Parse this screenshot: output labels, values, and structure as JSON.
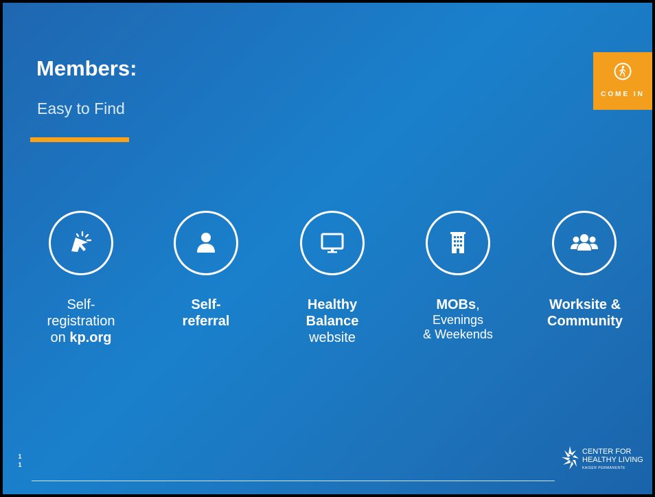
{
  "slide": {
    "title": "Members:",
    "subtitle": "Easy to Find",
    "badge": {
      "icon": "walking-person-icon",
      "label": "COME IN",
      "color": "#f39e1d"
    },
    "accent_color": "#f7a21a",
    "page_number": [
      "1",
      "1"
    ],
    "logo": {
      "line1": "CENTER FOR",
      "line2": "HEALTHY LIVING",
      "sub": "KAISER PERMANENTE"
    }
  },
  "items": [
    {
      "icon": "cursor-click-icon",
      "line1": "Self-",
      "line2": "registration",
      "line3_pre": "on ",
      "line3_bold": "kp.org"
    },
    {
      "icon": "person-icon",
      "line1": "Self-",
      "line2": "referral"
    },
    {
      "icon": "monitor-icon",
      "line1": "Healthy",
      "line2": "Balance",
      "line3": "website"
    },
    {
      "icon": "building-icon",
      "line1_bold": "MOBs",
      "line1_rest": ",",
      "line2": "Evenings",
      "line3": "& Weekends"
    },
    {
      "icon": "group-icon",
      "line1": "Worksite &",
      "line2": "Community"
    }
  ]
}
